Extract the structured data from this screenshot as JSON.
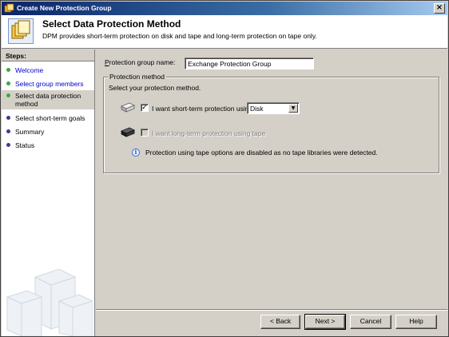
{
  "window": {
    "title": "Create New Protection Group",
    "close_glyph": "×"
  },
  "header": {
    "title": "Select Data Protection Method",
    "subtitle": "DPM provides short-term protection on disk and tape and long-term protection on tape only."
  },
  "sidebar": {
    "heading": "Steps:",
    "items": [
      {
        "label": "Welcome",
        "state": "done"
      },
      {
        "label": "Select group members",
        "state": "done"
      },
      {
        "label": "Select data protection method",
        "state": "active"
      },
      {
        "label": "Select short-term goals",
        "state": "pending"
      },
      {
        "label": "Summary",
        "state": "pending"
      },
      {
        "label": "Status",
        "state": "pending"
      }
    ]
  },
  "form": {
    "name_label": "Protection group name:",
    "name_value": "Exchange Protection Group",
    "groupbox_title": "Protection method",
    "instruction": "Select your protection method.",
    "short_term": {
      "checked": true,
      "check_glyph": "✓",
      "label": "I want short-term protection using:",
      "method_value": "Disk",
      "arrow_glyph": "▼"
    },
    "long_term": {
      "checked": false,
      "label": "I want long-term protection using tape",
      "disabled": true
    },
    "info_glyph": "i",
    "info_text": "Protection using tape options are disabled as no tape libraries were detected."
  },
  "buttons": {
    "back": "< Back",
    "next": "Next >",
    "cancel": "Cancel",
    "help": "Help"
  },
  "colors": {
    "title_bar": "#0a246a",
    "step_done": "#3da83d",
    "step_pending": "#3b3b8f",
    "link_blue": "#0000cc"
  }
}
